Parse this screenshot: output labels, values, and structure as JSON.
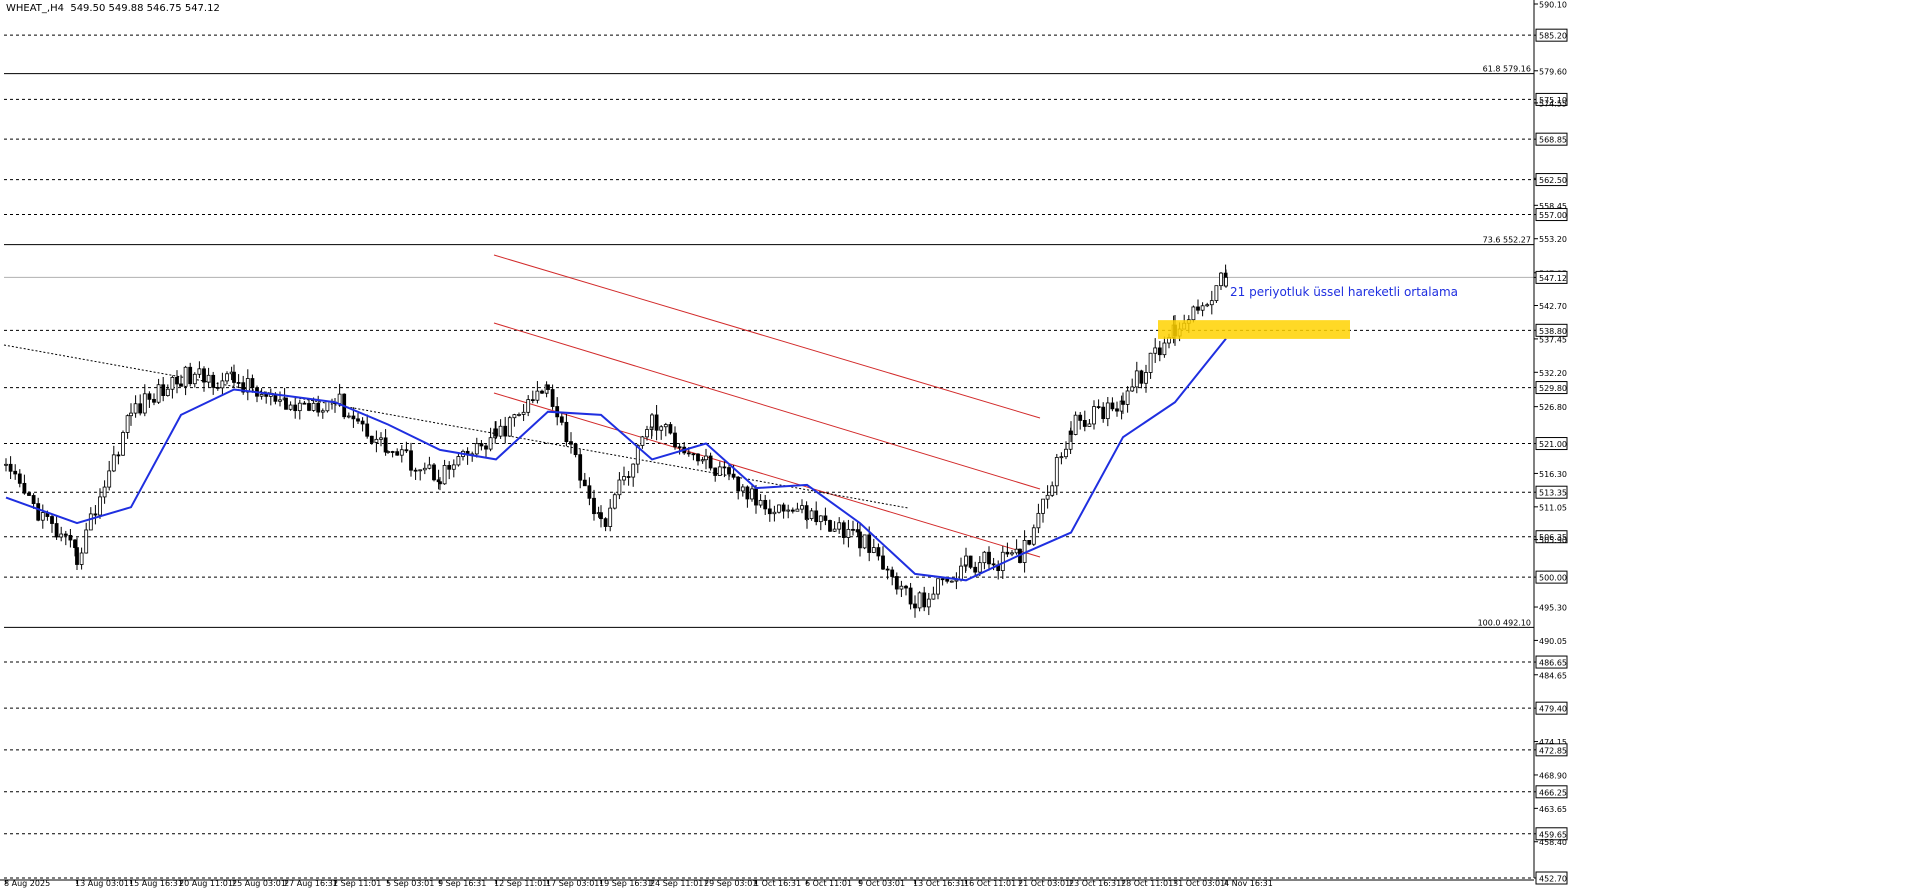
{
  "header": {
    "symbol": "WHEAT_,H4",
    "ohlc": "549.50 549.88 546.75 547.12"
  },
  "annotation": {
    "ema_label": "21 periyotluk üssel hareketli ortalama"
  },
  "colors": {
    "background": "#ffffff",
    "candle": "#000000",
    "ema": "#1f2fe0",
    "channel": "#d22b2b",
    "zone": "#ffd200",
    "grid": "#000000",
    "last_price_bg": "#ffffff"
  },
  "chart_data": {
    "type": "candlestick",
    "symbol": "WHEAT_",
    "timeframe": "H4",
    "ylim": [
      452.7,
      590.1
    ],
    "grid": false,
    "last_price": 547.12,
    "y_ticks": [
      "590.10",
      "585.20",
      "579.60",
      "575.10",
      "574.55",
      "568.85",
      "562.70",
      "562.50",
      "558.45",
      "557.00",
      "553.20",
      "547.85",
      "547.12",
      "542.70",
      "538.80",
      "537.45",
      "532.20",
      "529.80",
      "526.80",
      "521.00",
      "516.30",
      "513.35",
      "511.05",
      "506.35",
      "505.90",
      "500.00",
      "495.30",
      "490.05",
      "486.65",
      "484.65",
      "479.40",
      "474.15",
      "472.85",
      "468.90",
      "466.25",
      "463.65",
      "459.65",
      "458.40",
      "452.70"
    ],
    "x_labels": [
      "8 Aug 2025",
      "13 Aug 03:01",
      "15 Aug 16:31",
      "20 Aug 11:01",
      "25 Aug 03:01",
      "27 Aug 16:31",
      "2 Sep 11:01",
      "5 Sep 03:01",
      "9 Sep 16:31",
      "12 Sep 11:01",
      "17 Sep 03:01",
      "19 Sep 16:31",
      "24 Sep 11:01",
      "29 Sep 03:01",
      "1 Oct 16:31",
      "6 Oct 11:01",
      "9 Oct 03:01",
      "13 Oct 16:31",
      "16 Oct 11:01",
      "21 Oct 03:01",
      "23 Oct 16:31",
      "28 Oct 11:01",
      "31 Oct 03:01",
      "4 Nov 16:31"
    ],
    "dashed_levels": [
      {
        "price": 585.2,
        "label": "585.20"
      },
      {
        "price": 575.1,
        "label": "575.10"
      },
      {
        "price": 568.85,
        "label": "568.85"
      },
      {
        "price": 562.5,
        "label": "562.50"
      },
      {
        "price": 557.0,
        "label": "557.00"
      },
      {
        "price": 538.8,
        "label": "538.80"
      },
      {
        "price": 529.8,
        "label": "529.80"
      },
      {
        "price": 521.0,
        "label": "521.00"
      },
      {
        "price": 513.35,
        "label": "513.35"
      },
      {
        "price": 506.35,
        "label": "506.35"
      },
      {
        "price": 500.0,
        "label": "500.00"
      },
      {
        "price": 486.65,
        "label": "486.65"
      },
      {
        "price": 479.4,
        "label": "479.40"
      },
      {
        "price": 472.85,
        "label": "472.85"
      },
      {
        "price": 466.25,
        "label": "466.25"
      },
      {
        "price": 459.65,
        "label": "459.65"
      },
      {
        "price": 452.7,
        "label": "452.70"
      }
    ],
    "fib_levels": [
      {
        "price": 579.16,
        "label": "61.8 579.16"
      },
      {
        "price": 552.27,
        "label": "73.6 552.27"
      },
      {
        "price": 492.1,
        "label": "100.0 492.10"
      }
    ],
    "key_points": [
      {
        "x": "8 Aug 2025",
        "y": 516.5
      },
      {
        "x": "13 Aug 03:01",
        "y": 503.0
      },
      {
        "x": "15 Aug 16:31",
        "y": 526.0
      },
      {
        "x": "20 Aug 11:01",
        "y": 531.5
      },
      {
        "x": "25 Aug 03:01",
        "y": 531.0
      },
      {
        "x": "27 Aug 16:31",
        "y": 526.5
      },
      {
        "x": "2 Sep 11:01",
        "y": 528.0
      },
      {
        "x": "5 Sep 03:01",
        "y": 520.0
      },
      {
        "x": "9 Sep 16:31",
        "y": 516.0
      },
      {
        "x": "12 Sep 11:01",
        "y": 522.0
      },
      {
        "x": "17 Sep 03:01",
        "y": 530.0
      },
      {
        "x": "19 Sep 16:31",
        "y": 508.0
      },
      {
        "x": "24 Sep 11:01",
        "y": 524.5
      },
      {
        "x": "29 Sep 03:01",
        "y": 518.0
      },
      {
        "x": "1 Oct 16:31",
        "y": 512.0
      },
      {
        "x": "6 Oct 11:01",
        "y": 510.0
      },
      {
        "x": "9 Oct 03:01",
        "y": 506.0
      },
      {
        "x": "13 Oct 16:31",
        "y": 495.5
      },
      {
        "x": "16 Oct 11:01",
        "y": 502.0
      },
      {
        "x": "21 Oct 03:01",
        "y": 503.0
      },
      {
        "x": "23 Oct 16:31",
        "y": 523.5
      },
      {
        "x": "28 Oct 11:01",
        "y": 528.0
      },
      {
        "x": "31 Oct 03:01",
        "y": 539.0
      },
      {
        "x": "4 Nov 16:31",
        "y": 547.1
      }
    ],
    "ema_period": 21,
    "ema_points": [
      {
        "x": "8 Aug 2025",
        "y": 512.5
      },
      {
        "x": "13 Aug 03:01",
        "y": 508.5
      },
      {
        "x": "15 Aug 16:31",
        "y": 511.0
      },
      {
        "x": "20 Aug 11:01",
        "y": 525.5
      },
      {
        "x": "25 Aug 03:01",
        "y": 529.5
      },
      {
        "x": "27 Aug 16:31",
        "y": 528.5
      },
      {
        "x": "2 Sep 11:01",
        "y": 527.5
      },
      {
        "x": "5 Sep 03:01",
        "y": 524.0
      },
      {
        "x": "9 Sep 16:31",
        "y": 520.0
      },
      {
        "x": "12 Sep 11:01",
        "y": 518.5
      },
      {
        "x": "17 Sep 03:01",
        "y": 526.0
      },
      {
        "x": "19 Sep 16:31",
        "y": 525.5
      },
      {
        "x": "24 Sep 11:01",
        "y": 518.5
      },
      {
        "x": "29 Sep 03:01",
        "y": 521.0
      },
      {
        "x": "1 Oct 16:31",
        "y": 514.0
      },
      {
        "x": "6 Oct 11:01",
        "y": 514.5
      },
      {
        "x": "9 Oct 03:01",
        "y": 508.5
      },
      {
        "x": "13 Oct 16:31",
        "y": 500.5
      },
      {
        "x": "16 Oct 11:01",
        "y": 499.5
      },
      {
        "x": "21 Oct 03:01",
        "y": 503.5
      },
      {
        "x": "23 Oct 16:31",
        "y": 507.0
      },
      {
        "x": "28 Oct 11:01",
        "y": 522.0
      },
      {
        "x": "31 Oct 03:01",
        "y": 527.5
      },
      {
        "x": "4 Nov 16:31",
        "y": 537.5
      }
    ],
    "zone": {
      "from": 537.45,
      "to": 540.4
    }
  }
}
